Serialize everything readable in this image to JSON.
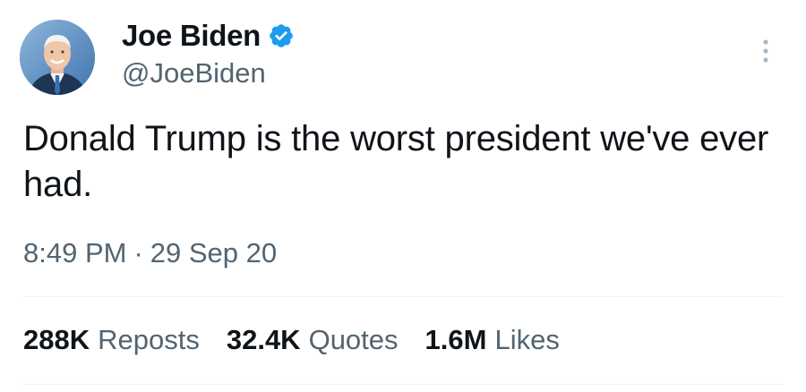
{
  "tweet": {
    "author": {
      "display_name": "Joe Biden",
      "handle": "@JoeBiden",
      "verified": true,
      "verified_color": "#1d9bf0"
    },
    "text": "Donald Trump is the worst president we've ever had.",
    "time": "8:49 PM",
    "separator": "·",
    "date": "29 Sep 20",
    "stats": [
      {
        "count": "288K",
        "label": "Reposts"
      },
      {
        "count": "32.4K",
        "label": "Quotes"
      },
      {
        "count": "1.6M",
        "label": "Likes"
      }
    ]
  },
  "icons": {
    "avatar": "avatar-photo",
    "verified": "verified-badge-icon",
    "more": "more-options-icon"
  }
}
